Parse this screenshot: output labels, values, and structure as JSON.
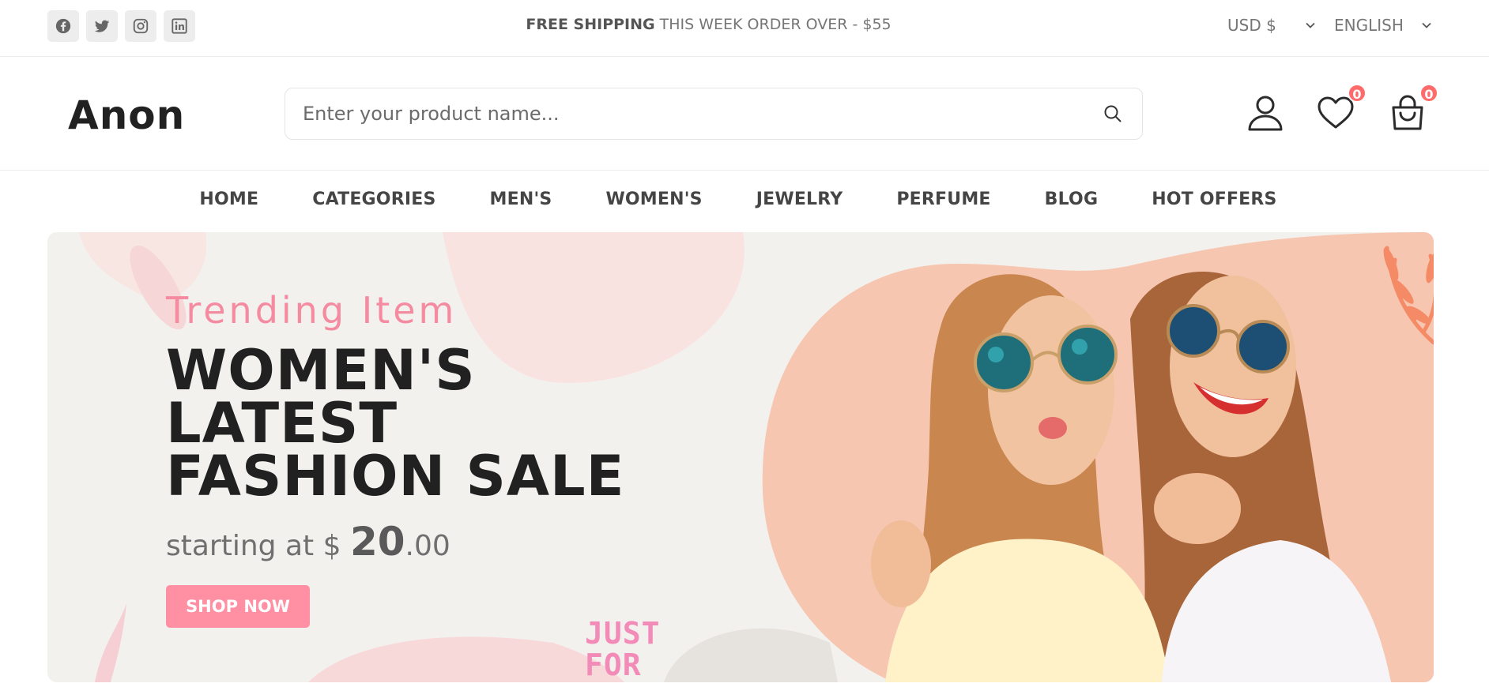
{
  "topbar": {
    "social": [
      {
        "icon": "facebook-icon"
      },
      {
        "icon": "twitter-icon"
      },
      {
        "icon": "instagram-icon"
      },
      {
        "icon": "linkedin-icon"
      }
    ],
    "shipping_bold": "FREE SHIPPING",
    "shipping_rest": " THIS WEEK ORDER OVER - $55",
    "currency": "USD $",
    "language": "ENGLISH"
  },
  "header": {
    "logo": "Anon",
    "search_placeholder": "Enter your product name...",
    "wishlist_count": "0",
    "cart_count": "0"
  },
  "nav": {
    "items": [
      "HOME",
      "CATEGORIES",
      "MEN'S",
      "WOMEN'S",
      "JEWELRY",
      "PERFUME",
      "BLOG",
      "HOT OFFERS"
    ]
  },
  "hero": {
    "subtitle": "Trending Item",
    "line1": "WOMEN'S",
    "line2": "LATEST",
    "line3": "FASHION SALE",
    "price_prefix": "starting at $ ",
    "price_big": "20",
    "price_cents": ".00",
    "button": "SHOP NOW",
    "sticker_line1": "JUST",
    "sticker_line2": "FOR"
  },
  "colors": {
    "accent": "#ff8fa3",
    "badge": "#ff6b6b",
    "hero_bg": "#f3f1ee",
    "hero_peach": "#f7c4ae"
  }
}
